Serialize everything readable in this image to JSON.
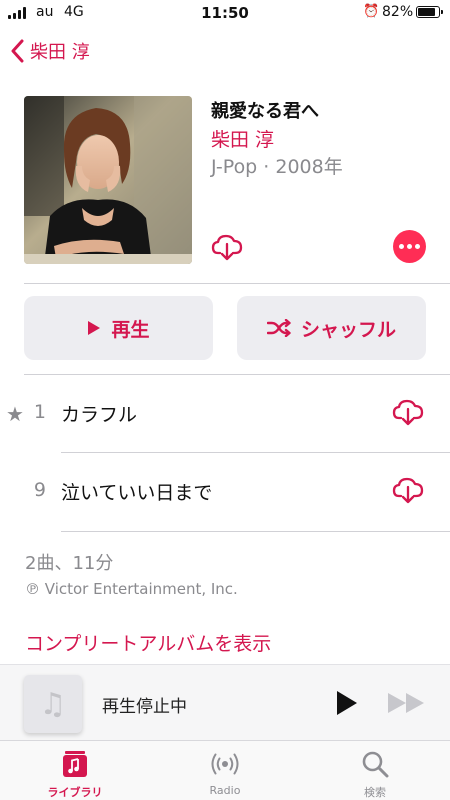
{
  "status_bar": {
    "carrier": "au",
    "network": "4G",
    "time": "11:50",
    "battery": "82%",
    "alarm_icon": "alarm-icon"
  },
  "nav": {
    "back_label": "柴田 淳"
  },
  "album": {
    "title": "親愛なる君へ",
    "artist": "柴田 淳",
    "meta": "J-Pop · 2008年"
  },
  "actions": {
    "play_label": "再生",
    "shuffle_label": "シャッフル"
  },
  "tracks": [
    {
      "number": "1",
      "title": "カラフル",
      "starred": true
    },
    {
      "number": "9",
      "title": "泣いていい日まで",
      "starred": false
    }
  ],
  "summary": "2曲、11分",
  "copyright": "℗ Victor Entertainment, Inc.",
  "complete_album_link": "コンプリートアルバムを表示",
  "mini_player": {
    "status": "再生停止中"
  },
  "tab_bar": {
    "items": [
      {
        "label": "ライブラリ",
        "icon": "library-icon",
        "active": true
      },
      {
        "label": "Radio",
        "icon": "radio-icon",
        "active": false
      },
      {
        "label": "検索",
        "icon": "search-icon",
        "active": false
      }
    ]
  },
  "colors": {
    "accent": "#d4174f",
    "more_button": "#ff2d55",
    "secondary_text": "#8a8a8e"
  }
}
